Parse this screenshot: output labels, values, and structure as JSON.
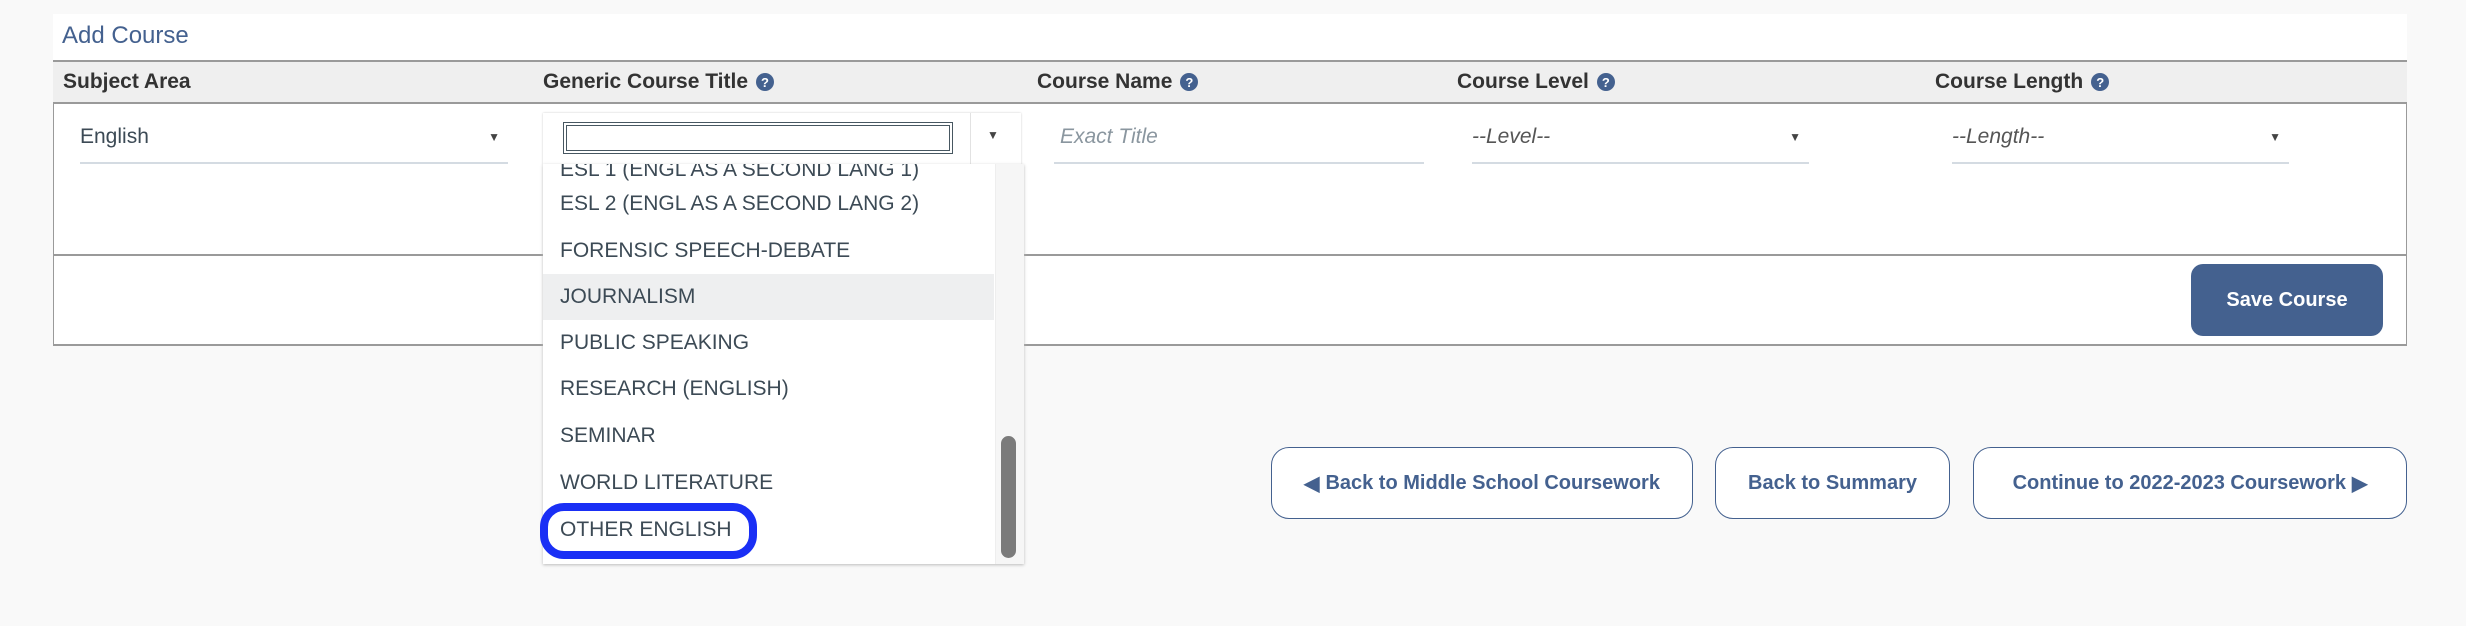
{
  "title": "Add Course",
  "headers": {
    "subject": "Subject Area",
    "generic": "Generic Course Title",
    "name": "Course Name",
    "level": "Course Level",
    "length": "Course Length"
  },
  "help_icon": "?",
  "fields": {
    "subject_value": "English",
    "generic_value": "",
    "name_placeholder": "Exact Title",
    "level_value": "--Level--",
    "length_value": "--Length--"
  },
  "dropdown": {
    "items": [
      "ESL 1 (ENGL AS A SECOND LANG 1)",
      "ESL 2 (ENGL AS A SECOND LANG 2)",
      "FORENSIC SPEECH-DEBATE",
      "JOURNALISM",
      "PUBLIC SPEAKING",
      "RESEARCH (ENGLISH)",
      "SEMINAR",
      "WORLD LITERATURE",
      "OTHER ENGLISH"
    ],
    "hovered": "JOURNALISM",
    "annotated": "OTHER ENGLISH",
    "annotation_color": "#1a2ff5"
  },
  "save_label": "Save Course",
  "nav": {
    "back_middle": "Back to Middle School Coursework",
    "back_summary": "Back to Summary",
    "continue": "Continue to 2022-2023 Coursework"
  },
  "colors": {
    "accent": "#44618f"
  }
}
